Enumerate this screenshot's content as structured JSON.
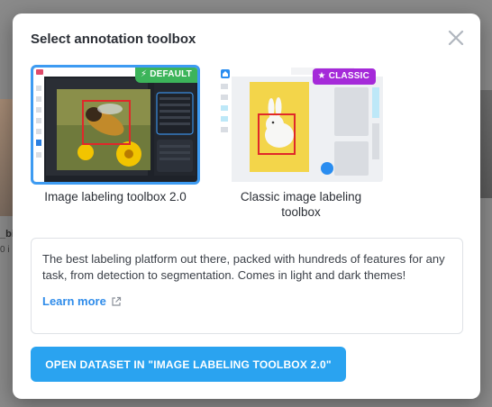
{
  "background": {
    "text_line_1": "_bi",
    "text_line_2": "0 i"
  },
  "modal": {
    "title": "Select annotation toolbox",
    "close_icon": "close-icon"
  },
  "options": [
    {
      "label": "Image labeling toolbox 2.0",
      "badge": "DEFAULT",
      "badge_icon": "lightning-icon",
      "badge_color": "#3cb45a",
      "selected": true
    },
    {
      "label": "Classic image labeling toolbox",
      "badge": "CLASSIC",
      "badge_icon": "star-icon",
      "badge_color": "#a52ad9",
      "selected": false
    }
  ],
  "description": {
    "text": "The best labeling platform out there, packed with hundreds of features for any task, from detection to segmentation. Comes in light and dark themes!",
    "learn_more": "Learn more",
    "learn_more_icon": "external-link-icon"
  },
  "primary_action": {
    "label": "OPEN DATASET IN \"IMAGE LABELING TOOLBOX 2.0\""
  },
  "colors": {
    "accent": "#2aa3f0",
    "link": "#2f8cea",
    "selection_border": "#3d9bf2"
  }
}
